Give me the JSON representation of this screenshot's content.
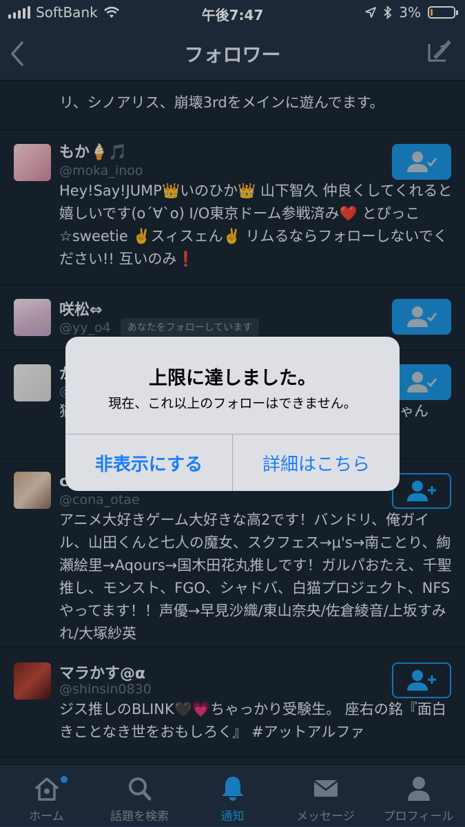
{
  "status_bar": {
    "carrier": "SoftBank",
    "time": "午後7:47",
    "battery": "3%",
    "battery_level": 0.03
  },
  "nav": {
    "title": "フォロワー"
  },
  "followers": [
    {
      "bio": "リ、シノアリス、崩壊3rdをメインに遊んでます。"
    },
    {
      "name": "もか🍦🎵",
      "handle": "@moka_inoo",
      "bio": "Hey!Say!JUMP👑いのひか👑 山下智久 仲良くしてくれると嬉しいです(o´∀`o) I/O東京ドーム参戦済み❤️ とぴっこ☆sweetie ✌️スィスェん✌️ リムるならフォローしないでください!! 互いのみ❗",
      "state": "following"
    },
    {
      "name": "咲松⇔",
      "handle": "@yy_o4",
      "badge": "あなたをフォローしています",
      "state": "following"
    },
    {
      "name": "か",
      "handle": "@",
      "bio": "猫",
      "bio_tail": "ゃん",
      "state": "following"
    },
    {
      "name": "c",
      "handle": "@cona_otae",
      "bio": "アニメ大好きゲーム大好きな高2です！バンドリ、俺ガイル、山田くんと七人の魔女、スクフェス→μ's→南ことり、絢瀬絵里→Aqours→国木田花丸推しです！ガルパおたえ、千聖推し、モンスト、FGO、シャドバ、白猫プロジェクト、NFSやってます！！声優→早見沙織/東山奈央/佐倉綾音/上坂すみれ/大塚紗英",
      "state": "follow"
    },
    {
      "name": "マラかす@α",
      "handle": "@shinsin0830",
      "bio": "ジス推しのBLINK🖤💗ちゃっかり受験生。 座右の銘『面白きことなき世をおもしろく』 #アットアルファ",
      "state": "follow"
    }
  ],
  "alert": {
    "title": "上限に達しました。",
    "message": "現在、これ以上のフォローはできません。",
    "hide_button": "非表示にする",
    "details_button": "詳細はこちら"
  },
  "tabbar": [
    {
      "label": "ホーム",
      "icon": "home-icon"
    },
    {
      "label": "話題を検索",
      "icon": "search-icon"
    },
    {
      "label": "通知",
      "icon": "bell-icon"
    },
    {
      "label": "メッセージ",
      "icon": "envelope-icon"
    },
    {
      "label": "プロフィール",
      "icon": "profile-icon"
    }
  ],
  "colors": {
    "accent": "#1da1f2",
    "background": "#1b2836",
    "bar": "#243447",
    "alert_button": "#1a7ef5"
  }
}
